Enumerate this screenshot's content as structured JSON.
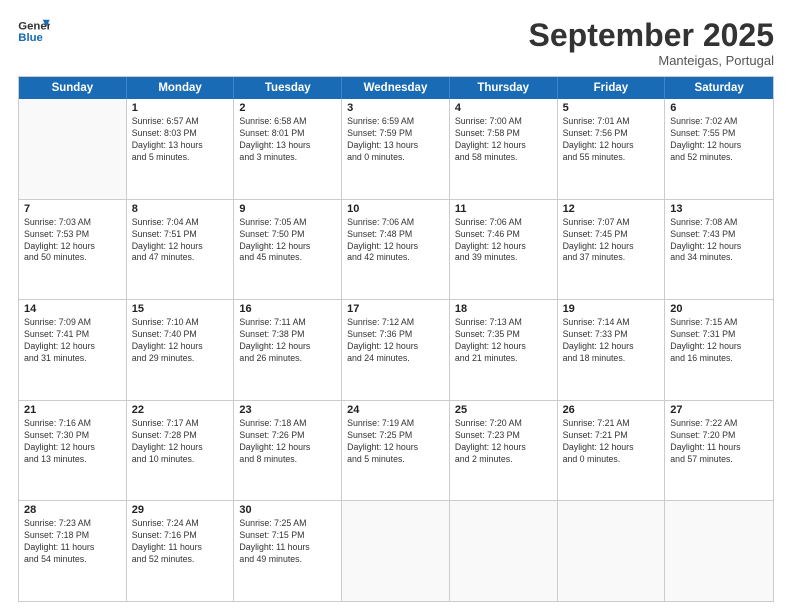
{
  "header": {
    "logo_line1": "General",
    "logo_line2": "Blue",
    "month": "September 2025",
    "location": "Manteigas, Portugal"
  },
  "weekdays": [
    "Sunday",
    "Monday",
    "Tuesday",
    "Wednesday",
    "Thursday",
    "Friday",
    "Saturday"
  ],
  "weeks": [
    [
      {
        "day": "",
        "info": ""
      },
      {
        "day": "1",
        "info": "Sunrise: 6:57 AM\nSunset: 8:03 PM\nDaylight: 13 hours\nand 5 minutes."
      },
      {
        "day": "2",
        "info": "Sunrise: 6:58 AM\nSunset: 8:01 PM\nDaylight: 13 hours\nand 3 minutes."
      },
      {
        "day": "3",
        "info": "Sunrise: 6:59 AM\nSunset: 7:59 PM\nDaylight: 13 hours\nand 0 minutes."
      },
      {
        "day": "4",
        "info": "Sunrise: 7:00 AM\nSunset: 7:58 PM\nDaylight: 12 hours\nand 58 minutes."
      },
      {
        "day": "5",
        "info": "Sunrise: 7:01 AM\nSunset: 7:56 PM\nDaylight: 12 hours\nand 55 minutes."
      },
      {
        "day": "6",
        "info": "Sunrise: 7:02 AM\nSunset: 7:55 PM\nDaylight: 12 hours\nand 52 minutes."
      }
    ],
    [
      {
        "day": "7",
        "info": "Sunrise: 7:03 AM\nSunset: 7:53 PM\nDaylight: 12 hours\nand 50 minutes."
      },
      {
        "day": "8",
        "info": "Sunrise: 7:04 AM\nSunset: 7:51 PM\nDaylight: 12 hours\nand 47 minutes."
      },
      {
        "day": "9",
        "info": "Sunrise: 7:05 AM\nSunset: 7:50 PM\nDaylight: 12 hours\nand 45 minutes."
      },
      {
        "day": "10",
        "info": "Sunrise: 7:06 AM\nSunset: 7:48 PM\nDaylight: 12 hours\nand 42 minutes."
      },
      {
        "day": "11",
        "info": "Sunrise: 7:06 AM\nSunset: 7:46 PM\nDaylight: 12 hours\nand 39 minutes."
      },
      {
        "day": "12",
        "info": "Sunrise: 7:07 AM\nSunset: 7:45 PM\nDaylight: 12 hours\nand 37 minutes."
      },
      {
        "day": "13",
        "info": "Sunrise: 7:08 AM\nSunset: 7:43 PM\nDaylight: 12 hours\nand 34 minutes."
      }
    ],
    [
      {
        "day": "14",
        "info": "Sunrise: 7:09 AM\nSunset: 7:41 PM\nDaylight: 12 hours\nand 31 minutes."
      },
      {
        "day": "15",
        "info": "Sunrise: 7:10 AM\nSunset: 7:40 PM\nDaylight: 12 hours\nand 29 minutes."
      },
      {
        "day": "16",
        "info": "Sunrise: 7:11 AM\nSunset: 7:38 PM\nDaylight: 12 hours\nand 26 minutes."
      },
      {
        "day": "17",
        "info": "Sunrise: 7:12 AM\nSunset: 7:36 PM\nDaylight: 12 hours\nand 24 minutes."
      },
      {
        "day": "18",
        "info": "Sunrise: 7:13 AM\nSunset: 7:35 PM\nDaylight: 12 hours\nand 21 minutes."
      },
      {
        "day": "19",
        "info": "Sunrise: 7:14 AM\nSunset: 7:33 PM\nDaylight: 12 hours\nand 18 minutes."
      },
      {
        "day": "20",
        "info": "Sunrise: 7:15 AM\nSunset: 7:31 PM\nDaylight: 12 hours\nand 16 minutes."
      }
    ],
    [
      {
        "day": "21",
        "info": "Sunrise: 7:16 AM\nSunset: 7:30 PM\nDaylight: 12 hours\nand 13 minutes."
      },
      {
        "day": "22",
        "info": "Sunrise: 7:17 AM\nSunset: 7:28 PM\nDaylight: 12 hours\nand 10 minutes."
      },
      {
        "day": "23",
        "info": "Sunrise: 7:18 AM\nSunset: 7:26 PM\nDaylight: 12 hours\nand 8 minutes."
      },
      {
        "day": "24",
        "info": "Sunrise: 7:19 AM\nSunset: 7:25 PM\nDaylight: 12 hours\nand 5 minutes."
      },
      {
        "day": "25",
        "info": "Sunrise: 7:20 AM\nSunset: 7:23 PM\nDaylight: 12 hours\nand 2 minutes."
      },
      {
        "day": "26",
        "info": "Sunrise: 7:21 AM\nSunset: 7:21 PM\nDaylight: 12 hours\nand 0 minutes."
      },
      {
        "day": "27",
        "info": "Sunrise: 7:22 AM\nSunset: 7:20 PM\nDaylight: 11 hours\nand 57 minutes."
      }
    ],
    [
      {
        "day": "28",
        "info": "Sunrise: 7:23 AM\nSunset: 7:18 PM\nDaylight: 11 hours\nand 54 minutes."
      },
      {
        "day": "29",
        "info": "Sunrise: 7:24 AM\nSunset: 7:16 PM\nDaylight: 11 hours\nand 52 minutes."
      },
      {
        "day": "30",
        "info": "Sunrise: 7:25 AM\nSunset: 7:15 PM\nDaylight: 11 hours\nand 49 minutes."
      },
      {
        "day": "",
        "info": ""
      },
      {
        "day": "",
        "info": ""
      },
      {
        "day": "",
        "info": ""
      },
      {
        "day": "",
        "info": ""
      }
    ]
  ]
}
